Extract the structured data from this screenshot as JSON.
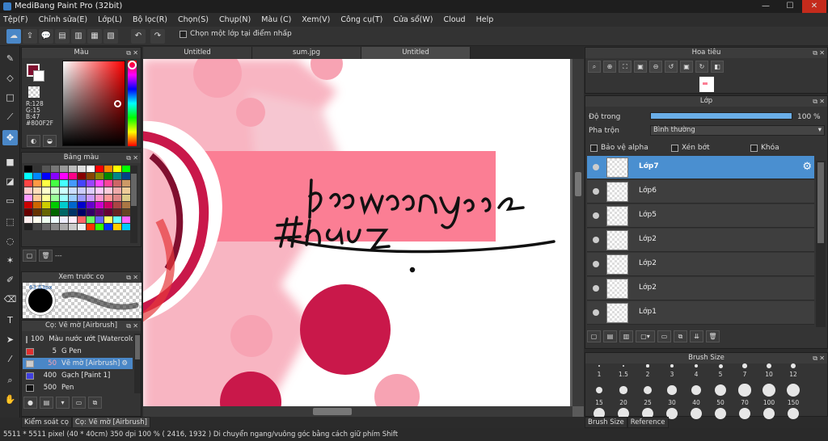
{
  "window": {
    "title": "MediBang Paint Pro (32bit)"
  },
  "menu": [
    "Tệp(F)",
    "Chỉnh sửa(E)",
    "Lớp(L)",
    "Bộ lọc(R)",
    "Chọn(S)",
    "Chụp(N)",
    "Màu (C)",
    "Xem(V)",
    "Công cụ(T)",
    "Cửa sổ(W)",
    "Cloud",
    "Help"
  ],
  "toolbar": {
    "checkbox_label": "Chọn một lớp tại điểm nhấp"
  },
  "panels": {
    "color": "Màu",
    "palette": "Bảng màu",
    "brush_preview": "Xem trước cọ",
    "brush": "Cọ: Vẽ mờ [Airbrush]",
    "navigator": "Hoa tiêu",
    "layer": "Lớp",
    "brush_size": "Brush Size"
  },
  "color": {
    "fg": "#800F2F",
    "r": "R:128",
    "g": "G:15",
    "b": "B:47",
    "hex": "#800F2F"
  },
  "palette_footer": "---",
  "brush_preview_size": "63.63px",
  "brushes": [
    {
      "size": "100",
      "name": "Màu nước ướt [Watercolor]",
      "color": "#5fc8f0"
    },
    {
      "size": "5",
      "name": "G Pen",
      "color": "#e03030"
    },
    {
      "size": "50",
      "name": "Vẽ mờ [Airbrush]",
      "color": "#cccccc"
    },
    {
      "size": "400",
      "name": "Gạch [Paint 1]",
      "color": "#4040e0"
    },
    {
      "size": "500",
      "name": "Pen",
      "color": "#111111"
    }
  ],
  "left_tabs": [
    "Kiểm soát cọ",
    "Cọ: Vẽ mờ [Airbrush]"
  ],
  "doc_tabs": [
    "Untitled",
    "sum.jpg",
    "Untitled"
  ],
  "layer": {
    "opacity_label": "Độ trong",
    "opacity_value": "100 %",
    "blend_label": "Pha trộn",
    "blend_value": "Bình thường",
    "protect_alpha": "Bảo vệ alpha",
    "clipping": "Xén bớt",
    "lock": "Khóa",
    "layers": [
      "Lớp7",
      "Lớp6",
      "Lớp5",
      "Lớp2",
      "Lớp2",
      "Lớp2",
      "Lớp1"
    ]
  },
  "brush_sizes_row1": [
    "1",
    "1.5",
    "2",
    "3",
    "4",
    "5",
    "7",
    "10",
    "12"
  ],
  "brush_sizes_row2": [
    "15",
    "20",
    "25",
    "30",
    "40",
    "50",
    "70",
    "100",
    "150"
  ],
  "right_tabs": [
    "Brush Size",
    "Reference"
  ],
  "status": "5511 * 5511 pixel   (40 * 40cm)   350 dpi   100 %   ( 2416, 1932 )   Di chuyển ngang/vuông góc bằng cách giữ phím Shift"
}
